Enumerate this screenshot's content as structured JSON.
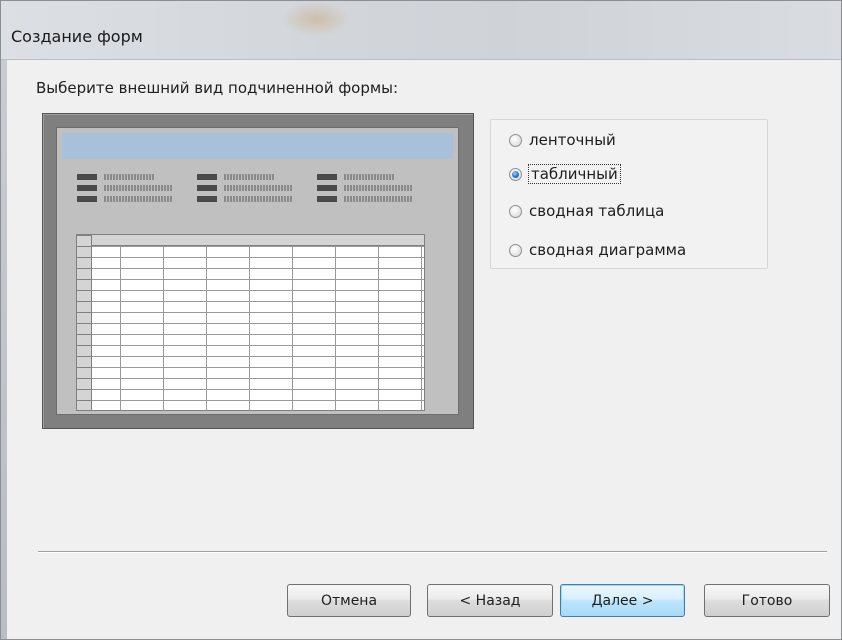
{
  "window": {
    "title": "Создание форм"
  },
  "prompt": "Выберите внешний вид подчиненной формы:",
  "options": {
    "items": [
      {
        "label": "ленточный",
        "checked": false
      },
      {
        "label": "табличный",
        "checked": true
      },
      {
        "label": "сводная таблица",
        "checked": false
      },
      {
        "label": "сводная диаграмма",
        "checked": false
      }
    ]
  },
  "buttons": {
    "cancel": "Отмена",
    "back": "< Назад",
    "next": "Далее >",
    "finish": "Готово"
  },
  "colors": {
    "preview_header": "#a9c0da",
    "radio_selected": "#1e6fc6",
    "default_button_border": "#3c7fb1"
  }
}
